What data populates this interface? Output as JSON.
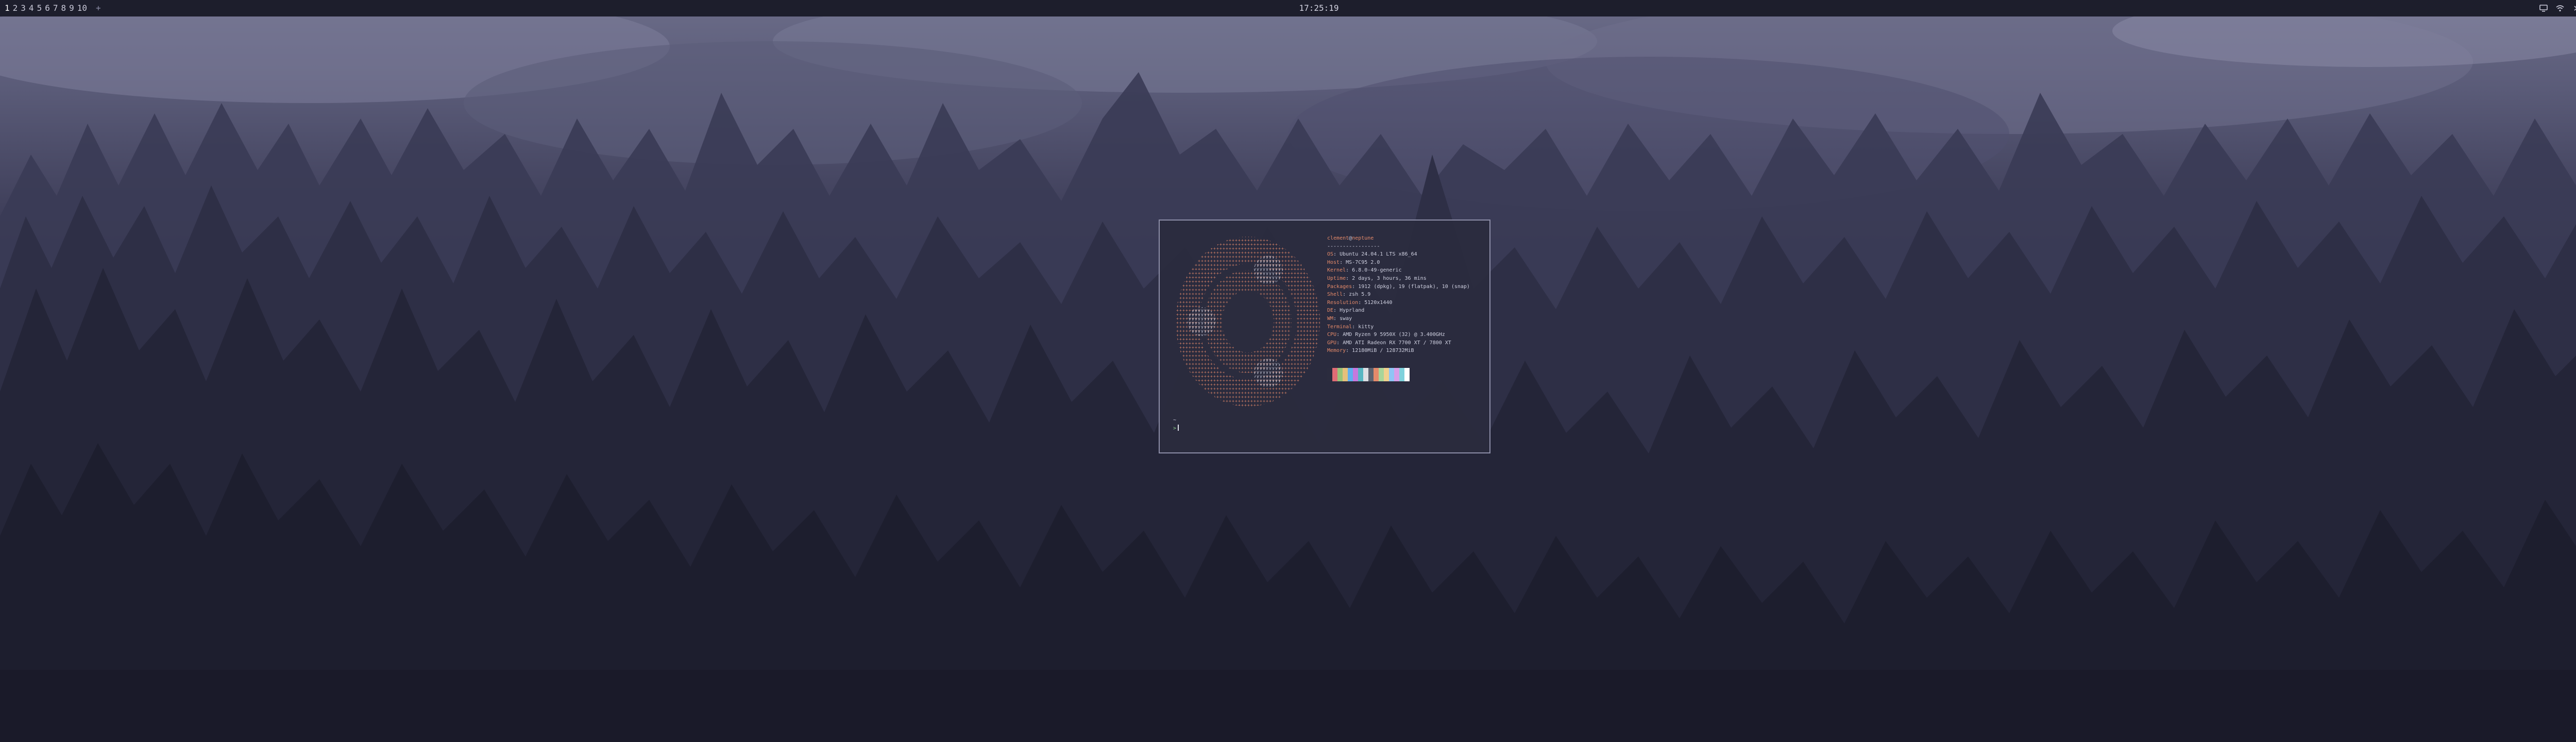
{
  "topbar": {
    "workspaces": [
      "1",
      "2",
      "3",
      "4",
      "5",
      "6",
      "7",
      "8",
      "9",
      "10"
    ],
    "active_workspace": "1",
    "more_symbol": "+",
    "clock": "17:25:19",
    "tray_icons": [
      "monitor-icon",
      "wifi-icon",
      "bluetooth-icon",
      "volume-icon",
      "notification-icon",
      "power-icon"
    ],
    "accent": "#e0567a"
  },
  "terminal": {
    "user": "clement",
    "at": "@",
    "host": "neptune",
    "separator": "-----------------",
    "info": [
      {
        "key": "OS",
        "value": "Ubuntu 24.04.1 LTS x86_64"
      },
      {
        "key": "Host",
        "value": "MS-7C95 2.0"
      },
      {
        "key": "Kernel",
        "value": "6.8.0-49-generic"
      },
      {
        "key": "Uptime",
        "value": "2 days, 3 hours, 36 mins"
      },
      {
        "key": "Packages",
        "value": "1912 (dpkg), 19 (flatpak), 10 (snap)"
      },
      {
        "key": "Shell",
        "value": "zsh 5.9"
      },
      {
        "key": "Resolution",
        "value": "5120x1440"
      },
      {
        "key": "DE",
        "value": "Hyprland"
      },
      {
        "key": "WM",
        "value": "sway"
      },
      {
        "key": "Terminal",
        "value": "kitty"
      },
      {
        "key": "CPU",
        "value": "AMD Ryzen 9 5950X (32) @ 3.400GHz"
      },
      {
        "key": "GPU",
        "value": "AMD ATI Radeon RX 7700 XT / 7800 XT"
      },
      {
        "key": "Memory",
        "value": "12180MiB / 128732MiB"
      }
    ],
    "palette": [
      "#2b2c3e",
      "#e06c75",
      "#98c379",
      "#e5c07b",
      "#61afef",
      "#c678dd",
      "#56b6c2",
      "#dcdfe4",
      "#5c6370",
      "#e58a6a",
      "#a8d59a",
      "#f0d08e",
      "#8fc5f5",
      "#d79ee8",
      "#7fd1dc",
      "#ffffff"
    ],
    "prompt_path": "~",
    "prompt_symbol": ">"
  }
}
